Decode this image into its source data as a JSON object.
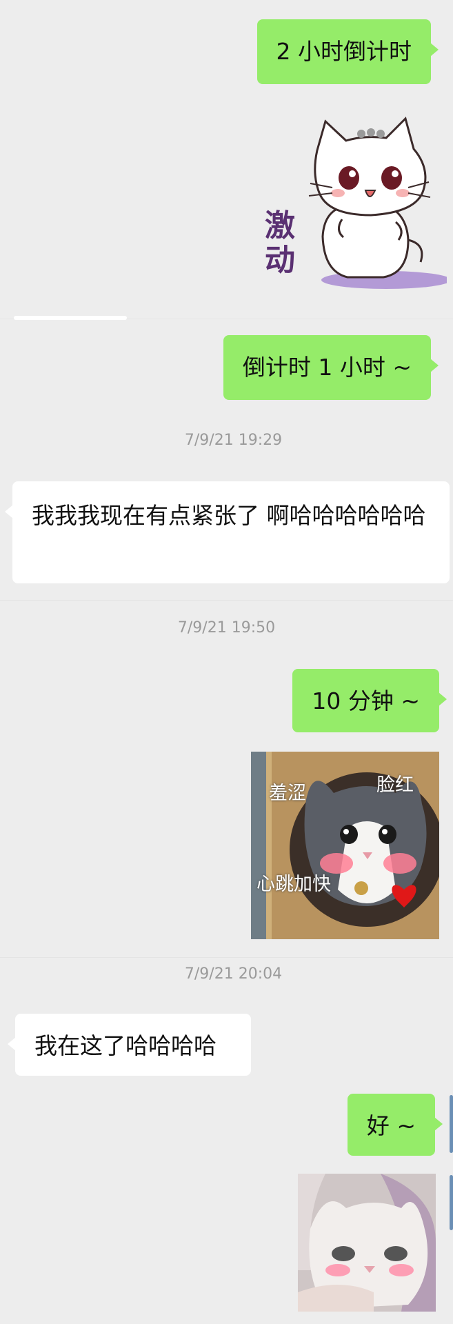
{
  "messages": [
    {
      "side": "me",
      "type": "text",
      "text": "2 小时倒计时"
    },
    {
      "side": "me",
      "type": "sticker",
      "sticker": "cat-excited-sticker",
      "caption": "激动"
    },
    {
      "side": "me",
      "type": "text",
      "text": "倒计时 1 小时 ~"
    },
    {
      "type": "timestamp",
      "text": "7/9/21 19:29"
    },
    {
      "side": "them",
      "type": "text",
      "text": "我我我现在有点紧张了 啊哈哈哈哈哈哈"
    },
    {
      "type": "timestamp",
      "text": "7/9/21 19:50"
    },
    {
      "side": "me",
      "type": "text",
      "text": "10 分钟 ~"
    },
    {
      "side": "me",
      "type": "sticker",
      "sticker": "blushing-cat-photo",
      "labels": [
        "羞涩",
        "脸红",
        "心跳加快"
      ]
    },
    {
      "type": "timestamp",
      "text": "7/9/21 20:04"
    },
    {
      "side": "them",
      "type": "text",
      "text": "我在这了哈哈哈哈"
    },
    {
      "side": "me",
      "type": "text",
      "text": "好 ~"
    },
    {
      "side": "me",
      "type": "sticker",
      "sticker": "white-cat-photo"
    }
  ],
  "colors": {
    "background": "#ededed",
    "me_bubble": "#95ec69",
    "them_bubble": "#ffffff",
    "timestamp": "#9a9a9a"
  }
}
